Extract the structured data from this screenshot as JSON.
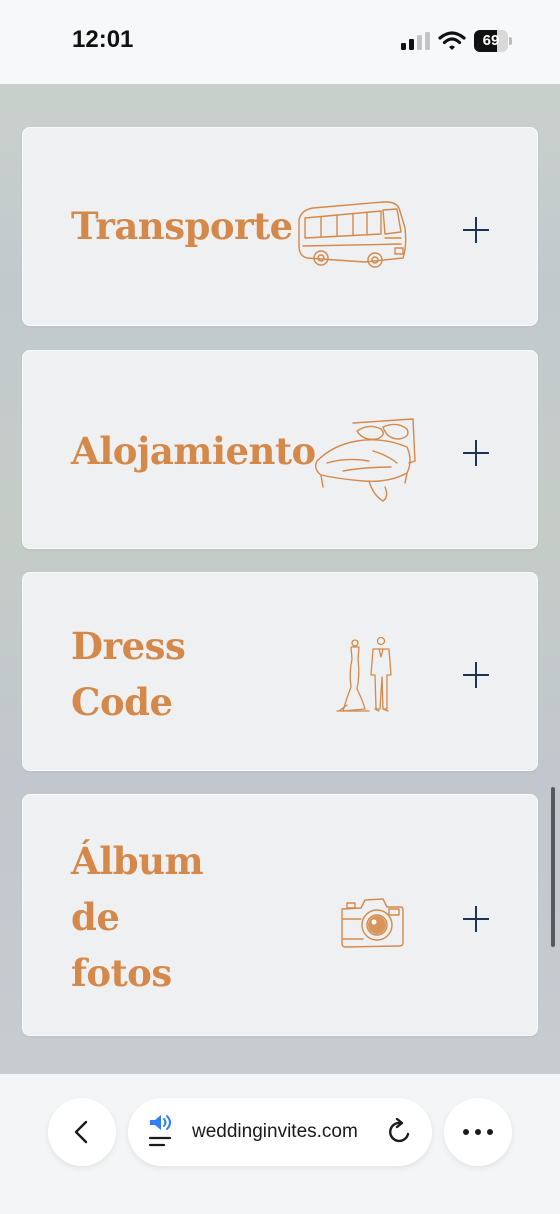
{
  "status_bar": {
    "time": "12:01",
    "battery_level": "69",
    "battery_fraction": 0.69
  },
  "cards": [
    {
      "title": "Transporte",
      "illustration": "bus-icon",
      "action_icon": "plus-icon"
    },
    {
      "title": "Alojamiento",
      "illustration": "bed-icon",
      "action_icon": "plus-icon"
    },
    {
      "title": "Dress\nCode",
      "illustration": "bride-groom-icon",
      "action_icon": "plus-icon"
    },
    {
      "title": "Álbum\nde\nfotos",
      "illustration": "camera-icon",
      "action_icon": "plus-icon"
    }
  ],
  "browser": {
    "url": "weddinginvites.com",
    "back_icon": "chevron-left-icon",
    "reader_icon": "speaker-icon",
    "reload_icon": "reload-icon",
    "more_icon": "more-icon"
  },
  "colors": {
    "title": "#d4894a",
    "plus": "#1e3350",
    "accent_blue": "#2f7ff6"
  }
}
